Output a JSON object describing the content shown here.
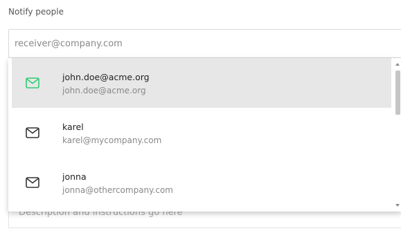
{
  "notify": {
    "label": "Notify people",
    "input_placeholder": "receiver@company.com"
  },
  "description": {
    "placeholder": "Description and instructions go here"
  },
  "dropdown": {
    "items": [
      {
        "name": "john.doe@acme.org",
        "email": "john.doe@acme.org",
        "selected": true,
        "icon": "mail-icon",
        "icon_color": "#2ecc71"
      },
      {
        "name": "karel",
        "email": "karel@mycompany.com",
        "selected": false,
        "icon": "mail-icon",
        "icon_color": "#333333"
      },
      {
        "name": "jonna",
        "email": "jonna@othercompany.com",
        "selected": false,
        "icon": "mail-icon",
        "icon_color": "#333333"
      }
    ]
  },
  "colors": {
    "selected_bg": "#e7e7e7",
    "accent_green": "#2ecc71"
  }
}
